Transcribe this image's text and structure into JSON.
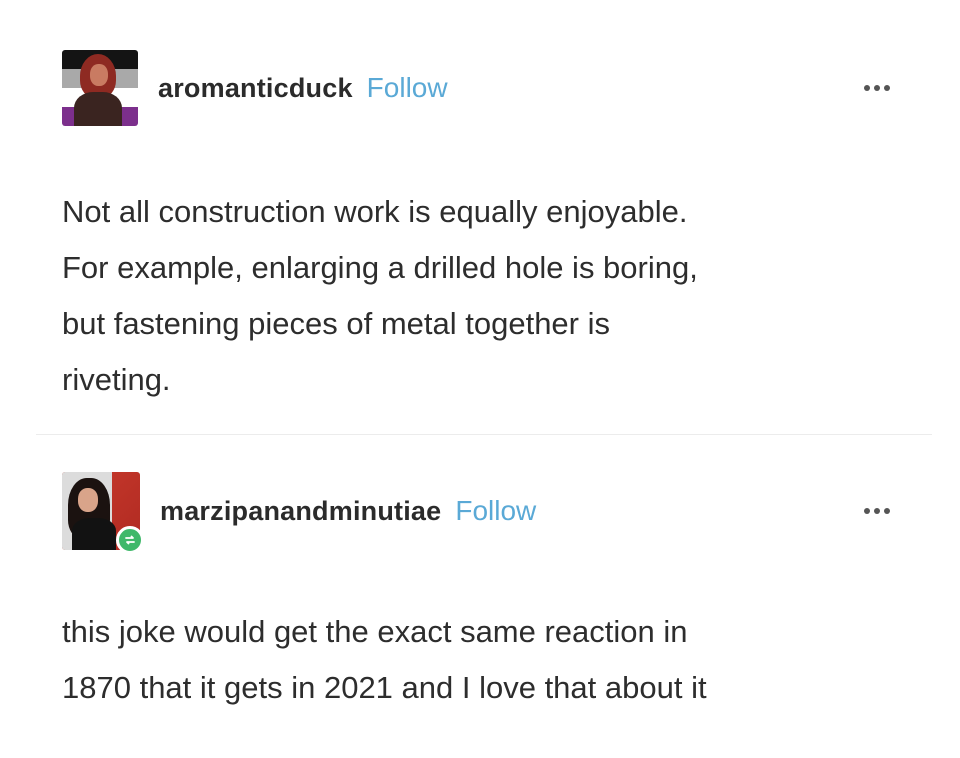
{
  "posts": [
    {
      "username": "aromanticduck",
      "follow_label": "Follow",
      "more_icon": "more-horizontal-icon",
      "body_lines": [
        "Not all construction work is equally enjoyable.",
        "For example, enlarging a drilled hole is boring,",
        "but fastening pieces of metal together is",
        "riveting."
      ]
    },
    {
      "username": "marzipanandminutiae",
      "follow_label": "Follow",
      "more_icon": "more-horizontal-icon",
      "badge_icon": "reblog-icon",
      "body_lines": [
        "this joke would get the exact same reaction in",
        "1870 that it gets in 2021 and I love that about it"
      ]
    }
  ],
  "colors": {
    "follow": "#5aa9d6",
    "text": "#2d2d2d",
    "reblog_badge": "#3fb86a"
  }
}
